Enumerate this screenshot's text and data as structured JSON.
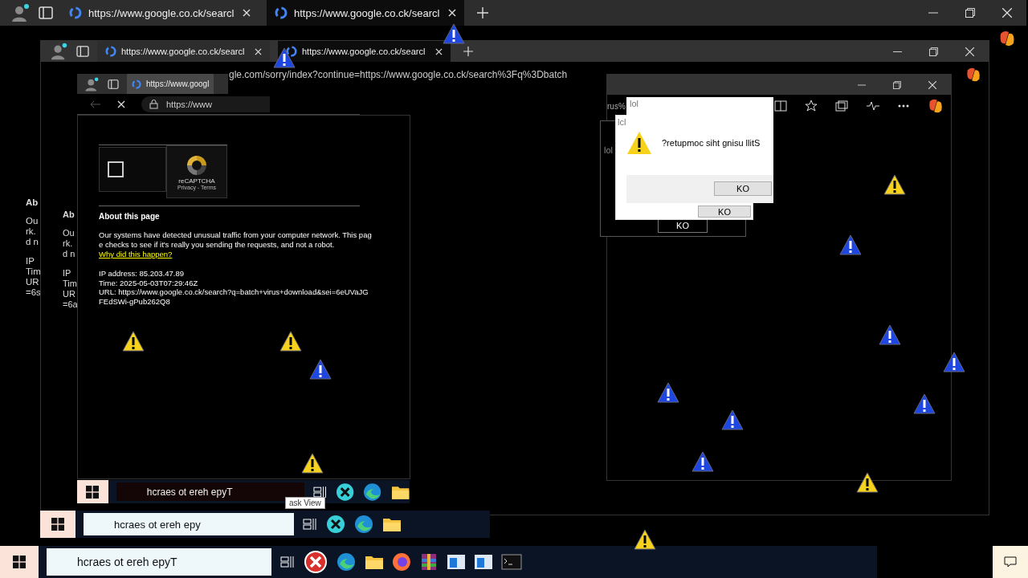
{
  "desktop_fragments": [
    {
      "lines": [
        "Ab",
        "Ou",
        "rk.",
        "d n",
        "IP",
        "Tim",
        "UR",
        "=6s"
      ]
    },
    {
      "lines": [
        "Ab",
        "Ou",
        "rk.",
        "d n",
        "IP",
        "Tim",
        "UR",
        "=6a"
      ]
    }
  ],
  "browser_windows": [
    {
      "tabs": [
        {
          "title": "https://www.google.co.ck/searcl",
          "selected": false
        },
        {
          "title": "https://www.google.co.ck/searcl",
          "selected": true
        }
      ]
    },
    {
      "tabs": [
        {
          "title": "https://www.google.co.ck/searcl",
          "selected": false
        },
        {
          "title": "https://www.google.co.ck/searcl",
          "selected": true
        }
      ],
      "address": "gle.com/sorry/index?continue=https://www.google.co.ck/search%3Fq%3Dbatch"
    },
    {
      "tabs": [
        {
          "title": "https://www.googl",
          "selected": true
        }
      ],
      "address": "https://www"
    }
  ],
  "side_window": {
    "address": "rus%"
  },
  "captcha_page": {
    "checked": false,
    "recaptcha_label": "reCAPTCHA",
    "recaptcha_links": "Privacy - Terms",
    "heading": "About this page",
    "paragraph": "Our systems have detected unusual traffic from your computer network. This page checks to see if it's really you sending the requests, and not a robot.",
    "link": "Why did this happen?",
    "details": [
      "IP address: 85.203.47.89",
      "Time: 2025-05-03T07:29:46Z",
      "URL: https://www.google.co.ck/search?q=batch+virus+download&sei=6eUVaJGFEdSWi-gPub262Q8"
    ]
  },
  "dialogs": [
    {
      "title": "lol",
      "button": "KO"
    },
    {
      "title": "lcl",
      "button": "KO"
    },
    {
      "title": "lol",
      "message": "?retupmoc siht gnisu llitS",
      "button": "KO"
    }
  ],
  "taskbars": [
    {
      "search": "hcraes ot ereh epyT"
    },
    {
      "search": "hcraes ot ereh epy",
      "tooltip": "ask View"
    },
    {
      "search": "hcraes ot ereh epyT"
    }
  ]
}
